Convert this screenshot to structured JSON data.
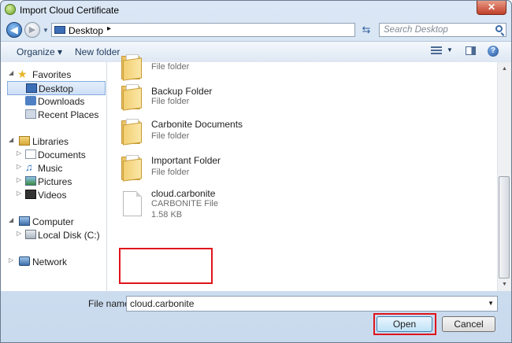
{
  "window": {
    "title": "Import Cloud Certificate",
    "close_label": "✕"
  },
  "address": {
    "location": "Desktop",
    "chevron": "▸",
    "search_placeholder": "Search Desktop"
  },
  "toolbar": {
    "organize_label": "Organize ▾",
    "new_folder_label": "New folder"
  },
  "nav": {
    "favorites": "Favorites",
    "desktop": "Desktop",
    "downloads": "Downloads",
    "recent": "Recent Places",
    "libraries": "Libraries",
    "documents": "Documents",
    "music": "Music",
    "pictures": "Pictures",
    "videos": "Videos",
    "computer": "Computer",
    "local_disk": "Local Disk (C:)",
    "network": "Network"
  },
  "files": [
    {
      "name": "",
      "type": "File folder"
    },
    {
      "name": "Backup Folder",
      "type": "File folder"
    },
    {
      "name": "Carbonite Documents",
      "type": "File folder"
    },
    {
      "name": "Important Folder",
      "type": "File folder"
    },
    {
      "name": "cloud.carbonite",
      "type": "CARBONITE File",
      "size": "1.58 KB"
    }
  ],
  "bottom": {
    "file_name_label": "File name:",
    "file_name_value": "cloud.carbonite",
    "open_label": "Open",
    "cancel_label": "Cancel"
  },
  "colors": {
    "highlight": "#e0141b",
    "accent": "#3d6fb6"
  }
}
